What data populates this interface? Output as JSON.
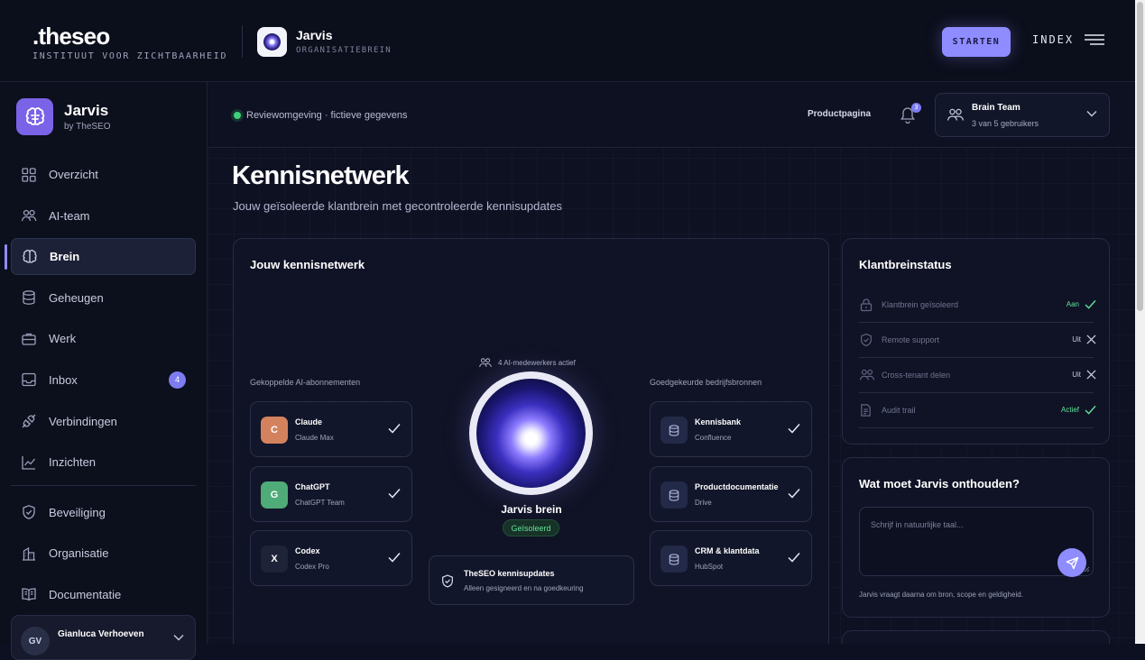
{
  "topbar": {
    "logo_word": ".theseo",
    "logo_tag": "INSTITUUT VOOR ZICHTBAARHEID",
    "app_name": "Jarvis",
    "app_sub": "ORGANISATIEBREIN",
    "start_label": "STARTEN",
    "index_label": "INDEX"
  },
  "sidebar": {
    "brand_name": "Jarvis",
    "brand_by": "by TheSEO",
    "items": [
      {
        "label": "Overzicht",
        "icon": "grid-icon"
      },
      {
        "label": "AI-team",
        "icon": "users-icon"
      },
      {
        "label": "Brein",
        "icon": "brain-icon",
        "active": true
      },
      {
        "label": "Geheugen",
        "icon": "database-icon"
      },
      {
        "label": "Werk",
        "icon": "briefcase-icon"
      },
      {
        "label": "Inbox",
        "icon": "inbox-icon",
        "badge": "4"
      },
      {
        "label": "Verbindingen",
        "icon": "plug-icon"
      },
      {
        "label": "Inzichten",
        "icon": "chart-icon"
      },
      {
        "label": "Beveiliging",
        "icon": "shield-icon"
      },
      {
        "label": "Organisatie",
        "icon": "building-icon"
      },
      {
        "label": "Documentatie",
        "icon": "book-icon"
      }
    ],
    "user": {
      "initials": "GV",
      "name": "Gianluca Verhoeven"
    }
  },
  "header": {
    "env_label": "Reviewomgeving · fictieve gegevens",
    "product_link": "Productpagina",
    "notif_count": "3",
    "team_name": "Brain Team",
    "team_count": "3 van 5 gebruikers"
  },
  "page": {
    "title": "Kennisnetwerk",
    "subtitle": "Jouw geïsoleerde klantbrein met gecontroleerde kennisupdates"
  },
  "network": {
    "title": "Jouw kennisnetwerk",
    "left_header": "Gekoppelde AI-abonnementen",
    "right_header": "Goedgekeurde bedrijfsbronnen",
    "active_label": "4 AI-medewerkers actief",
    "brain_title": "Jarvis brein",
    "brain_badge": "Geïsoleerd",
    "subscriptions": [
      {
        "letter": "C",
        "name": "Claude",
        "plan": "Claude Max",
        "color": "#d4825e"
      },
      {
        "letter": "G",
        "name": "ChatGPT",
        "plan": "ChatGPT Team",
        "color": "#4fab78"
      },
      {
        "letter": "X",
        "name": "Codex",
        "plan": "Codex Pro",
        "color": "#1f2338"
      }
    ],
    "sources": [
      {
        "name": "Kennisbank",
        "plan": "Confluence"
      },
      {
        "name": "Productdocumentatie",
        "plan": "Drive"
      },
      {
        "name": "CRM & klantdata",
        "plan": "HubSpot"
      }
    ],
    "update_title": "TheSEO kennisupdates",
    "update_sub": "Alleen gesigneerd en na goedkeuring"
  },
  "status": {
    "title": "Klantbreinstatus",
    "rows": [
      {
        "label": "Klantbrein geïsoleerd",
        "value": "Aan",
        "ok": true,
        "icon": "lock-icon"
      },
      {
        "label": "Remote support",
        "value": "Uit",
        "ok": false,
        "icon": "shield-icon"
      },
      {
        "label": "Cross-tenant delen",
        "value": "Uit",
        "ok": false,
        "icon": "users-icon"
      },
      {
        "label": "Audit trail",
        "value": "Actief",
        "ok": true,
        "icon": "document-icon"
      }
    ]
  },
  "memory": {
    "title": "Wat moet Jarvis onthouden?",
    "placeholder": "Schrijf in natuurlijke taal...",
    "hint": "Jarvis vraagt daarna om bron, scope en geldigheid."
  },
  "colors": {
    "accent": "#8e8cff",
    "ok": "#5fe39a",
    "bg": "#0e1122"
  }
}
